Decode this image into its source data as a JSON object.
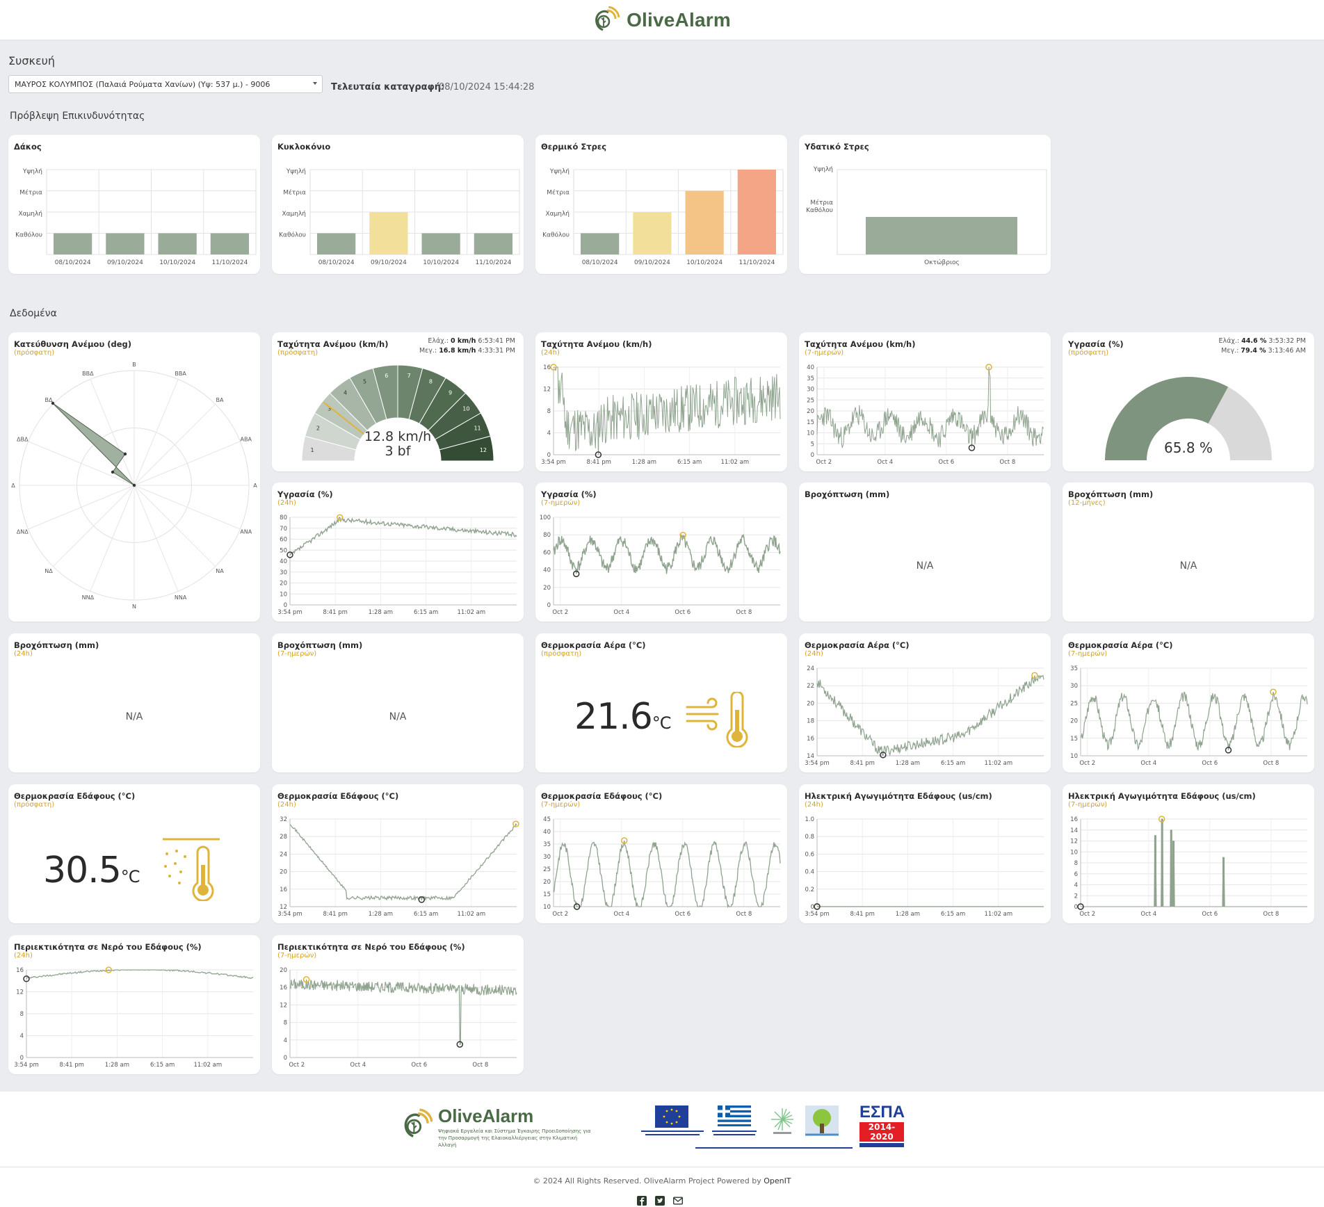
{
  "brand": {
    "name": "OliveAlarm"
  },
  "device": {
    "heading": "Συσκευή",
    "selected": "ΜΑΥΡΟΣ ΚΟΛΥΜΠΟΣ (Παλαιά Ρούματα Χανίων) (Υψ: 537 μ.) - 9006",
    "last_record_label": "Τελευταία καταγραφή:",
    "last_record_value": "08/10/2024 15:44:28"
  },
  "forecast": {
    "heading": "Πρόβλεψη Επικινδυνότητας",
    "levels": [
      "Καθόλου",
      "Χαμηλή",
      "Μέτρια",
      "Υψηλή"
    ],
    "dates": [
      "08/10/2024",
      "09/10/2024",
      "10/10/2024",
      "11/10/2024"
    ],
    "level_colors": [
      "#9aab9a",
      "#f2e09a",
      "#f4c487",
      "#f3a585"
    ],
    "cards": [
      {
        "title": "Δάκος",
        "values": [
          0,
          0,
          0,
          0
        ]
      },
      {
        "title": "Κυκλοκόνιο",
        "values": [
          0,
          1,
          0,
          0
        ]
      },
      {
        "title": "Θερμικό Στρες",
        "values": [
          0,
          1,
          2,
          3
        ]
      }
    ],
    "water": {
      "title": "Υδατικό Στρες",
      "levels": [
        "Καθόλου",
        "Μέτρια",
        "Υψηλή"
      ],
      "month": "Οκτώβριος",
      "value": 0
    }
  },
  "data": {
    "heading": "Δεδομένα",
    "sub_recent": "(πρόσφατη)",
    "sub_24h": "(24h)",
    "sub_7d": "(7-ημερών)",
    "sub_12m": "(12-μήνες)",
    "na": "N/A",
    "axis_24h": [
      "3:54 pm",
      "8:41 pm",
      "1:28 am",
      "6:15 am",
      "11:02 am"
    ],
    "axis_7d": [
      "Oct 2",
      "Oct 4",
      "Oct 6",
      "Oct 8"
    ],
    "wind_dir": {
      "title": "Κατεύθυνση Ανέμου (deg)",
      "directions": [
        "Β",
        "ΒΒΑ",
        "ΒΑ",
        "ΑΒΑ",
        "Α",
        "ΑΝΑ",
        "ΝΑ",
        "ΝΝΑ",
        "Ν",
        "ΝΝΔ",
        "ΝΔ",
        "ΔΝΔ",
        "Δ",
        "ΔΒΔ",
        "ΒΔ",
        "ΒΒΔ"
      ]
    },
    "wind_gauge": {
      "title": "Ταχύτητα Ανέμου (km/h)",
      "min_label": "Ελάχ.:",
      "min_value": "0 km/h",
      "min_time": "6:53:41 PM",
      "max_label": "Μεγ.:",
      "max_value": "16.8 km/h",
      "max_time": "4:33:31 PM",
      "value": "12.8 km/h",
      "bf": "3 bf",
      "value_num": 12.8,
      "scale": [
        "1",
        "2",
        "3",
        "4",
        "5",
        "6",
        "7",
        "8",
        "9",
        "10",
        "11",
        "12"
      ]
    },
    "wind_24h": {
      "title": "Ταχύτητα Ανέμου (km/h)",
      "yticks": [
        "0",
        "4",
        "8",
        "12",
        "16"
      ]
    },
    "wind_7d": {
      "title": "Ταχύτητα Ανέμου (km/h)",
      "yticks": [
        "0",
        "5",
        "10",
        "15",
        "20",
        "25",
        "30",
        "35",
        "40"
      ]
    },
    "humidity_gauge": {
      "title": "Υγρασία (%)",
      "min_label": "Ελάχ.:",
      "min_value": "44.6 %",
      "min_time": "3:53:32 PM",
      "max_label": "Μεγ.:",
      "max_value": "79.4 %",
      "max_time": "3:13:46 AM",
      "value": "65.8 %",
      "fraction": 0.658
    },
    "humidity_24h": {
      "title": "Υγρασία (%)",
      "yticks": [
        "0",
        "10",
        "20",
        "30",
        "40",
        "50",
        "60",
        "70",
        "80"
      ]
    },
    "humidity_7d": {
      "title": "Υγρασία (%)",
      "yticks": [
        "0",
        "20",
        "40",
        "60",
        "80",
        "100"
      ]
    },
    "rain_recent": {
      "title": "Βροχόπτωση (mm)"
    },
    "rain_12m": {
      "title": "Βροχόπτωση (mm)"
    },
    "rain_24h": {
      "title": "Βροχόπτωση (mm)"
    },
    "rain_7d": {
      "title": "Βροχόπτωση (mm)"
    },
    "air_temp_now": {
      "title": "Θερμοκρασία Αέρα (°C)",
      "value": "21.6",
      "unit": "°C"
    },
    "air_temp_24h": {
      "title": "Θερμοκρασία Αέρα (°C)",
      "yticks": [
        "14",
        "16",
        "18",
        "20",
        "22",
        "24"
      ]
    },
    "air_temp_7d": {
      "title": "Θερμοκρασία Αέρα (°C)",
      "yticks": [
        "10",
        "15",
        "20",
        "25",
        "30",
        "35"
      ]
    },
    "soil_temp_now": {
      "title": "Θερμοκρασία Εδάφους (°C)",
      "value": "30.5",
      "unit": "°C"
    },
    "soil_temp_24h": {
      "title": "Θερμοκρασία Εδάφους (°C)",
      "yticks": [
        "12",
        "16",
        "20",
        "24",
        "28",
        "32"
      ]
    },
    "soil_temp_7d": {
      "title": "Θερμοκρασία Εδάφους (°C)",
      "yticks": [
        "10",
        "15",
        "20",
        "25",
        "30",
        "35",
        "40",
        "45"
      ]
    },
    "ec_24h": {
      "title": "Ηλεκτρική Αγωγιμότητα Εδάφους (us/cm)",
      "yticks": [
        "0",
        "0.2",
        "0.4",
        "0.6",
        "0.8",
        "1.0"
      ]
    },
    "ec_7d": {
      "title": "Ηλεκτρική Αγωγιμότητα Εδάφους (us/cm)",
      "yticks": [
        "0",
        "2",
        "4",
        "6",
        "8",
        "10",
        "12",
        "14",
        "16"
      ]
    },
    "swc_24h": {
      "title": "Περιεκτικότητα σε Νερό του Εδάφους (%)",
      "yticks": [
        "0",
        "4",
        "8",
        "12",
        "16"
      ]
    },
    "swc_7d": {
      "title": "Περιεκτικότητα σε Νερό του Εδάφους (%)",
      "yticks": [
        "0",
        "4",
        "8",
        "12",
        "16",
        "20"
      ]
    }
  },
  "footer": {
    "brand": "OliveAlarm",
    "tagline": "Ψηφιακά Εργαλεία και Σύστημα Έγκαιρης Προειδοποίησης για την Προσαρμογή της Ελαιοκαλλιέργειας στην Κλιματική Αλλαγή",
    "espa": "ΕΣΠΑ",
    "espa_years": "2014-2020",
    "copyright": "© 2024 All Rights Reserved. OliveAlarm Project Powered by",
    "powered": "OpenIT"
  },
  "colors": {
    "series": "#8fa38f",
    "max_marker": "#e0b43a",
    "min_marker": "#333333",
    "accent": "#d4a227",
    "brand": "#4a6a45"
  }
}
